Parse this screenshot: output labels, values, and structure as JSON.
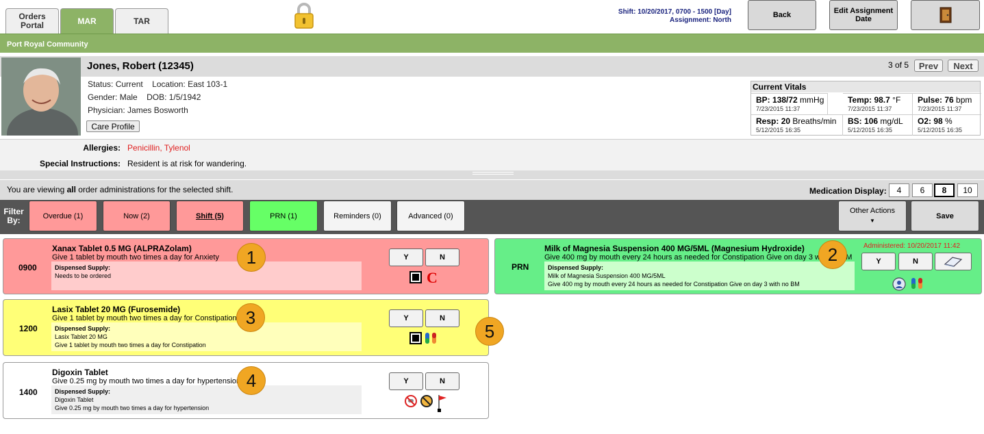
{
  "tabs": [
    {
      "label": "Orders Portal"
    },
    {
      "label": "MAR"
    },
    {
      "label": "TAR"
    }
  ],
  "header": {
    "shift_text": "Shift: 10/20/2017, 0700 - 1500 [Day]",
    "assignment_text": "Assignment: North",
    "back_label": "Back",
    "edit_assignment_label": "Edit Assignment Date",
    "facility": "Port Royal Community"
  },
  "patient": {
    "name": "Jones, Robert (12345)",
    "pager": "3 of 5",
    "prev_label": "Prev",
    "next_label": "Next",
    "status_label": "Status:",
    "status": "Current",
    "location_label": "Location:",
    "location": "East 103-1",
    "gender_label": "Gender:",
    "gender": "Male",
    "dob_label": "DOB:",
    "dob": "1/5/1942",
    "physician_label": "Physician:",
    "physician": "James Bosworth",
    "care_profile_label": "Care Profile",
    "allergies_label": "Allergies:",
    "allergies": "Penicillin, Tylenol",
    "special_label": "Special Instructions:",
    "special": "Resident is at risk for wandering."
  },
  "vitals": {
    "title": "Current Vitals",
    "bp_label": "BP:",
    "bp_value": "138/72",
    "bp_unit": " mmHg",
    "bp_date": "7/23/2015 11:37",
    "temp_label": "Temp:",
    "temp_value": "98.7",
    "temp_unit": " °F",
    "temp_date": "7/23/2015 11:37",
    "pulse_label": "Pulse:",
    "pulse_value": "76",
    "pulse_unit": " bpm",
    "pulse_date": "7/23/2015 11:37",
    "resp_label": "Resp:",
    "resp_value": "20",
    "resp_unit": " Breaths/min",
    "resp_date": "5/12/2015 16:35",
    "bs_label": "BS:",
    "bs_value": "106",
    "bs_unit": " mg/dL",
    "bs_date": "5/12/2015 16:35",
    "o2_label": "O2:",
    "o2_value": "98",
    "o2_unit": " %",
    "o2_date": "5/12/2015 16:35"
  },
  "viewing": {
    "pre": "You are viewing ",
    "bold": "all",
    "post": " order administrations for the selected shift.",
    "med_display_label": "Medication Display:",
    "options": [
      "4",
      "6",
      "8",
      "10"
    ],
    "selected": "8"
  },
  "filter": {
    "label": "Filter By:",
    "overdue": "Overdue (1)",
    "now": "Now (2)",
    "shift": "Shift (5)",
    "prn": "PRN (1)",
    "reminders": "Reminders (0)",
    "advanced": "Advanced (0)",
    "other_actions": "Other Actions",
    "save": "Save"
  },
  "yes_label": "Y",
  "no_label": "N",
  "dispensed_label": "Dispensed Supply:",
  "meds": [
    {
      "time": "0900",
      "title": "Xanax Tablet 0.5 MG (ALPRAZolam)",
      "sub": "Give 1 tablet by mouth two times a day for Anxiety",
      "disp_1": "Needs to be ordered",
      "disp_2": "",
      "marker": "1",
      "controlled": "C"
    },
    {
      "time": "PRN",
      "title": "Milk of Magnesia Suspension 400 MG/5ML (Magnesium Hydroxide)",
      "sub": "Give 400 mg by mouth every 24 hours as needed for Constipation Give on day 3 with no BM",
      "disp_1": "Milk of Magnesia Suspension 400 MG/5ML",
      "disp_2": "Give 400 mg by mouth every 24 hours as needed for Constipation Give on day 3 with no BM",
      "marker": "2",
      "administered": "Administered: 10/20/2017 11:42"
    },
    {
      "time": "1200",
      "title": "Lasix Tablet 20 MG (Furosemide)",
      "sub": "Give 1 tablet by mouth two times a day for Constipation",
      "disp_1": "Lasix Tablet 20 MG",
      "disp_2": "Give 1 tablet by mouth two times a day for Constipation",
      "marker": "3"
    },
    {
      "time": "1400",
      "title": "Digoxin Tablet",
      "sub": "Give 0.25 mg by mouth two times a day for hypertension",
      "disp_1": "Digoxin Tablet",
      "disp_2": "Give 0.25 mg by mouth two times a day for hypertension",
      "marker": "4"
    }
  ],
  "marker_5": "5",
  "colors": {
    "green": "#8db366",
    "overdue": "#ff9999",
    "prn": "#66ff66",
    "card_red": "#ff9999",
    "card_green": "#66ee88",
    "card_yellow": "#ffff77",
    "marker": "#f0a623"
  }
}
